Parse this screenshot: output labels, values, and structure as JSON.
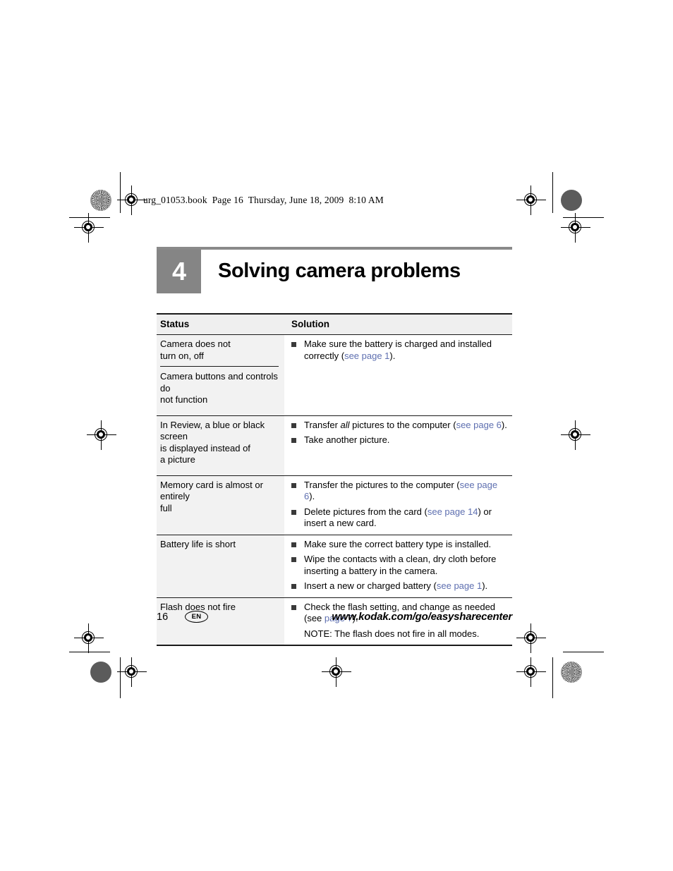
{
  "page_header": "urg_01053.book  Page 16  Thursday, June 18, 2009  8:10 AM",
  "chapter": {
    "number": "4",
    "title": "Solving camera problems",
    "accent_color": "#858585"
  },
  "table": {
    "headers": {
      "status": "Status",
      "solution": "Solution"
    },
    "link_color": "#5e6fb0",
    "rows": [
      {
        "status_parts": [
          "Camera does not\nturn on, off",
          "Camera buttons and controls do\nnot function"
        ],
        "bullets": [
          {
            "segments": [
              {
                "text": "Make sure the battery is charged and installed correctly (",
                "style": "normal"
              },
              {
                "text": "see page 1",
                "style": "link"
              },
              {
                "text": ").",
                "style": "normal"
              }
            ]
          }
        ]
      },
      {
        "status_parts": [
          "In Review, a blue or black screen\nis displayed instead of\na picture"
        ],
        "bullets": [
          {
            "segments": [
              {
                "text": "Transfer ",
                "style": "normal"
              },
              {
                "text": "all",
                "style": "italic"
              },
              {
                "text": " pictures to the computer (",
                "style": "normal"
              },
              {
                "text": "see page 6",
                "style": "link"
              },
              {
                "text": ").",
                "style": "normal"
              }
            ]
          },
          {
            "segments": [
              {
                "text": "Take another picture.",
                "style": "normal"
              }
            ]
          }
        ]
      },
      {
        "status_parts": [
          "Memory card is almost or entirely\nfull"
        ],
        "bullets": [
          {
            "segments": [
              {
                "text": "Transfer the pictures to the computer (",
                "style": "normal"
              },
              {
                "text": "see page 6",
                "style": "link"
              },
              {
                "text": ").",
                "style": "normal"
              }
            ]
          },
          {
            "segments": [
              {
                "text": "Delete pictures from the card (",
                "style": "normal"
              },
              {
                "text": "see page 14",
                "style": "link"
              },
              {
                "text": ") or insert a new card.",
                "style": "normal"
              }
            ]
          }
        ]
      },
      {
        "status_parts": [
          "Battery life is short"
        ],
        "bullets": [
          {
            "segments": [
              {
                "text": "Make sure the correct battery type is installed.",
                "style": "normal"
              }
            ]
          },
          {
            "segments": [
              {
                "text": "Wipe the contacts with a clean, dry cloth before inserting a battery in the camera.",
                "style": "normal"
              }
            ]
          },
          {
            "segments": [
              {
                "text": "Insert a new or charged battery (",
                "style": "normal"
              },
              {
                "text": "see page 1",
                "style": "link"
              },
              {
                "text": ").",
                "style": "normal"
              }
            ]
          }
        ]
      },
      {
        "status_parts": [
          "Flash does not fire"
        ],
        "bullets": [
          {
            "segments": [
              {
                "text": "Check the flash setting, and change as needed (see ",
                "style": "normal"
              },
              {
                "text": "page 7",
                "style": "link"
              },
              {
                "text": ").",
                "style": "normal"
              }
            ]
          }
        ],
        "note": "NOTE:  The flash does not fire in all modes."
      }
    ]
  },
  "footer": {
    "page_number": "16",
    "language_badge": "EN",
    "url": "www.kodak.com/go/easysharecenter"
  }
}
